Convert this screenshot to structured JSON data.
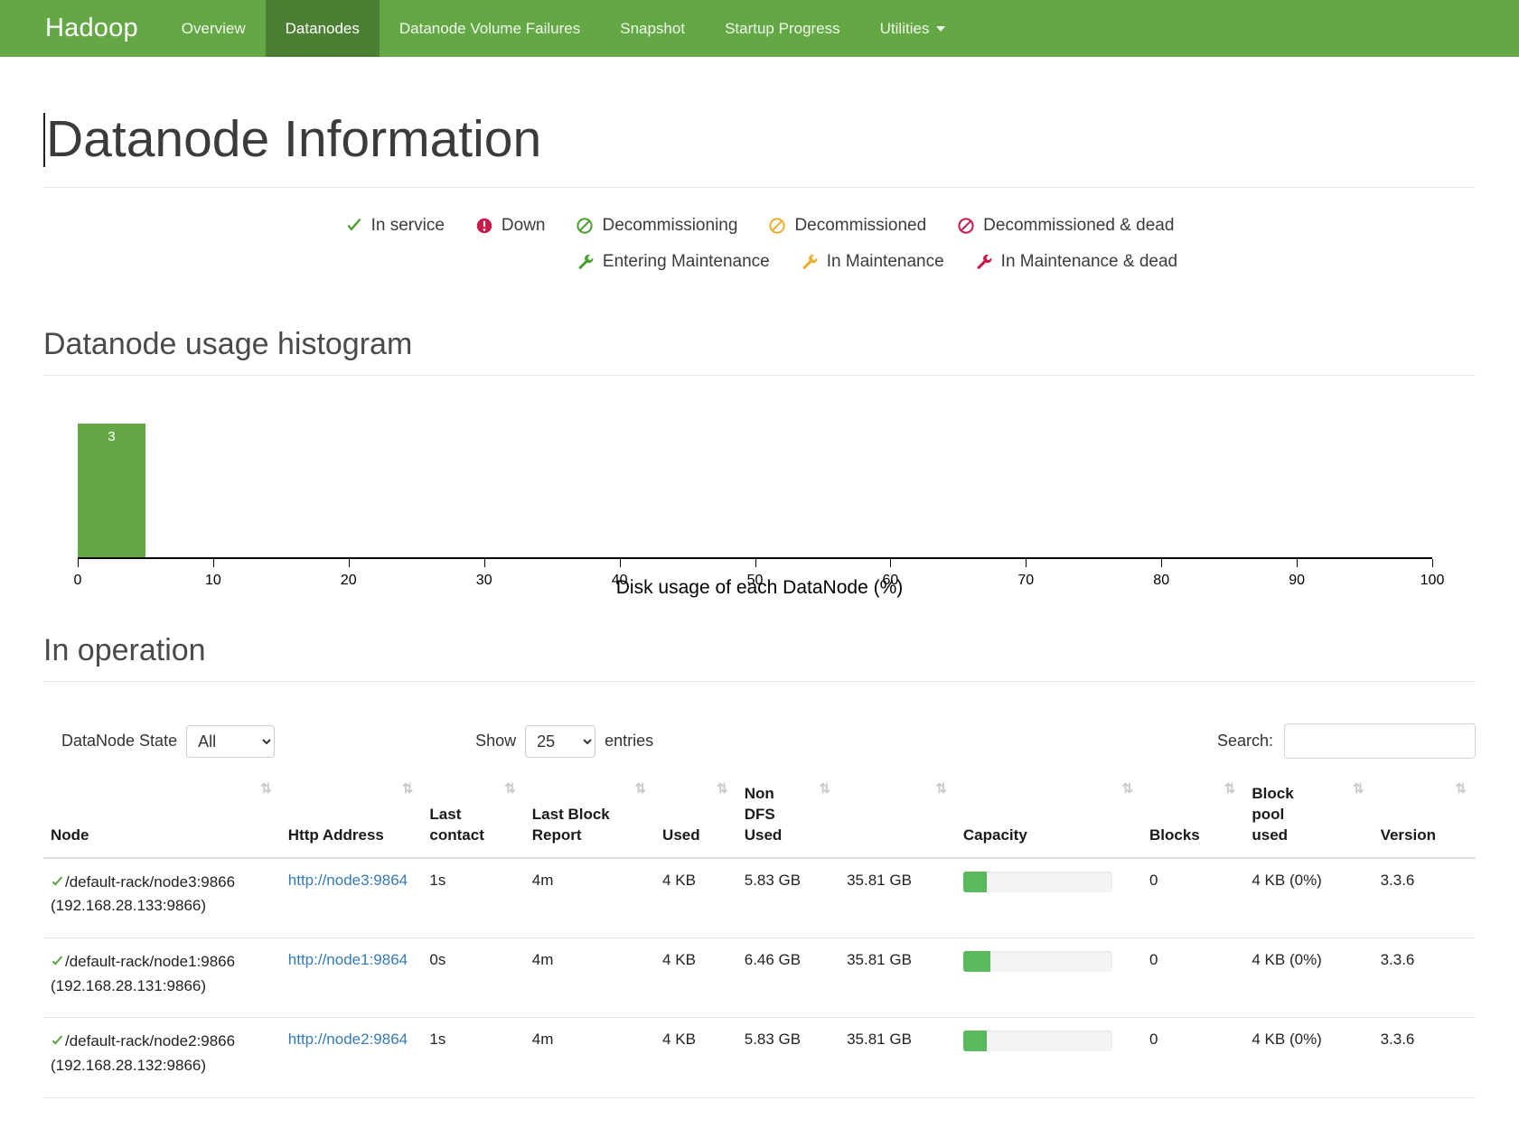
{
  "navbar": {
    "brand": "Hadoop",
    "items": [
      {
        "label": "Overview",
        "active": false
      },
      {
        "label": "Datanodes",
        "active": true
      },
      {
        "label": "Datanode Volume Failures",
        "active": false
      },
      {
        "label": "Snapshot",
        "active": false
      },
      {
        "label": "Startup Progress",
        "active": false
      },
      {
        "label": "Utilities",
        "active": false,
        "caret": true
      }
    ]
  },
  "page": {
    "title": "Datanode Information",
    "histogram_title": "Datanode usage histogram",
    "operation_title": "In operation"
  },
  "legend": {
    "row1": [
      {
        "label": "In service",
        "icon": "check-icon",
        "color": "#4a9e2f"
      },
      {
        "label": "Down",
        "icon": "exclamation-circle-icon",
        "color": "#c9184a"
      },
      {
        "label": "Decommissioning",
        "icon": "ban-circle-icon",
        "color": "#4a9e2f"
      },
      {
        "label": "Decommissioned",
        "icon": "ban-circle-icon",
        "color": "#f0ad2e"
      },
      {
        "label": "Decommissioned & dead",
        "icon": "ban-circle-icon",
        "color": "#c9184a"
      }
    ],
    "row2": [
      {
        "label": "Entering Maintenance",
        "icon": "wrench-icon",
        "color": "#4a9e2f"
      },
      {
        "label": "In Maintenance",
        "icon": "wrench-icon",
        "color": "#f0ad2e"
      },
      {
        "label": "In Maintenance & dead",
        "icon": "wrench-icon",
        "color": "#c9184a"
      }
    ]
  },
  "chart_data": {
    "type": "bar",
    "title": "Datanode usage histogram",
    "xlabel": "Disk usage of each DataNode (%)",
    "ylabel": "",
    "xlim": [
      0,
      100
    ],
    "ticks": [
      0,
      10,
      20,
      30,
      40,
      50,
      60,
      70,
      80,
      90,
      100
    ],
    "grid": false,
    "bars": [
      {
        "x_start": 0,
        "x_end": 5,
        "value": 3,
        "label": "3",
        "color": "#63a844"
      }
    ],
    "categories": [
      "0-5"
    ],
    "values": [
      3
    ]
  },
  "controls": {
    "state_label": "DataNode State",
    "state_value": "All",
    "state_options": [
      "All"
    ],
    "show_label": "Show",
    "entries_label": "entries",
    "length_value": "25",
    "length_options": [
      "25"
    ],
    "search_label": "Search:",
    "search_value": "",
    "search_placeholder": ""
  },
  "table": {
    "sort_icon": "⇅",
    "columns": [
      "Node",
      "Http Address",
      "Last\ncontact",
      "Last Block\nReport",
      "Used",
      "Non\nDFS\nUsed",
      "",
      "Capacity",
      "Blocks",
      "Block\npool\nused",
      "Version"
    ],
    "rows": [
      {
        "status_icon": "check-icon",
        "node": "/default-rack/node3:9866",
        "node_ip": "(192.168.28.133:9866)",
        "http_address": "http://node3:9864",
        "last_contact": "1s",
        "last_block_report": "4m",
        "used": "4 KB",
        "non_dfs_used": "5.83 GB",
        "capacity_text": "35.81 GB",
        "capacity_percent": 16,
        "blocks": "0",
        "block_pool_used": "4 KB (0%)",
        "version": "3.3.6"
      },
      {
        "status_icon": "check-icon",
        "node": "/default-rack/node1:9866",
        "node_ip": "(192.168.28.131:9866)",
        "http_address": "http://node1:9864",
        "last_contact": "0s",
        "last_block_report": "4m",
        "used": "4 KB",
        "non_dfs_used": "6.46 GB",
        "capacity_text": "35.81 GB",
        "capacity_percent": 18,
        "blocks": "0",
        "block_pool_used": "4 KB (0%)",
        "version": "3.3.6"
      },
      {
        "status_icon": "check-icon",
        "node": "/default-rack/node2:9866",
        "node_ip": "(192.168.28.132:9866)",
        "http_address": "http://node2:9864",
        "last_contact": "1s",
        "last_block_report": "4m",
        "used": "4 KB",
        "non_dfs_used": "5.83 GB",
        "capacity_text": "35.81 GB",
        "capacity_percent": 16,
        "blocks": "0",
        "block_pool_used": "4 KB (0%)",
        "version": "3.3.6"
      }
    ]
  }
}
